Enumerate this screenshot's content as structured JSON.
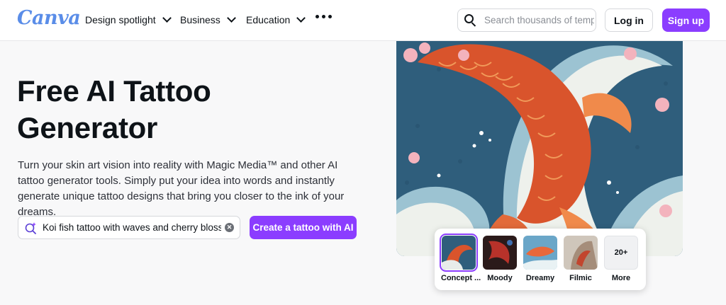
{
  "header": {
    "logo": "Canva",
    "nav": [
      {
        "label": "Design spotlight"
      },
      {
        "label": "Business"
      },
      {
        "label": "Education"
      }
    ],
    "search_placeholder": "Search thousands of templates",
    "login_label": "Log in",
    "signup_label": "Sign up"
  },
  "hero": {
    "title": "Free AI Tattoo Generator",
    "description": "Turn your skin art vision into reality with Magic Media™ and other AI tattoo generator tools. Simply put your idea into words and instantly generate unique tattoo designs that bring you closer to the ink of your dreams.",
    "prompt_value": "Koi fish tattoo with waves and cherry blossom",
    "create_button": "Create a tattoo with AI"
  },
  "styles": {
    "items": [
      {
        "label": "Concept ...",
        "selected": true
      },
      {
        "label": "Moody"
      },
      {
        "label": "Dreamy"
      },
      {
        "label": "Filmic"
      }
    ],
    "more_count": "20+",
    "more_label": "More"
  },
  "colors": {
    "accent": "#8b3dff",
    "logo_blue": "#5a8de8",
    "logo_purple": "#8a5ce6"
  }
}
